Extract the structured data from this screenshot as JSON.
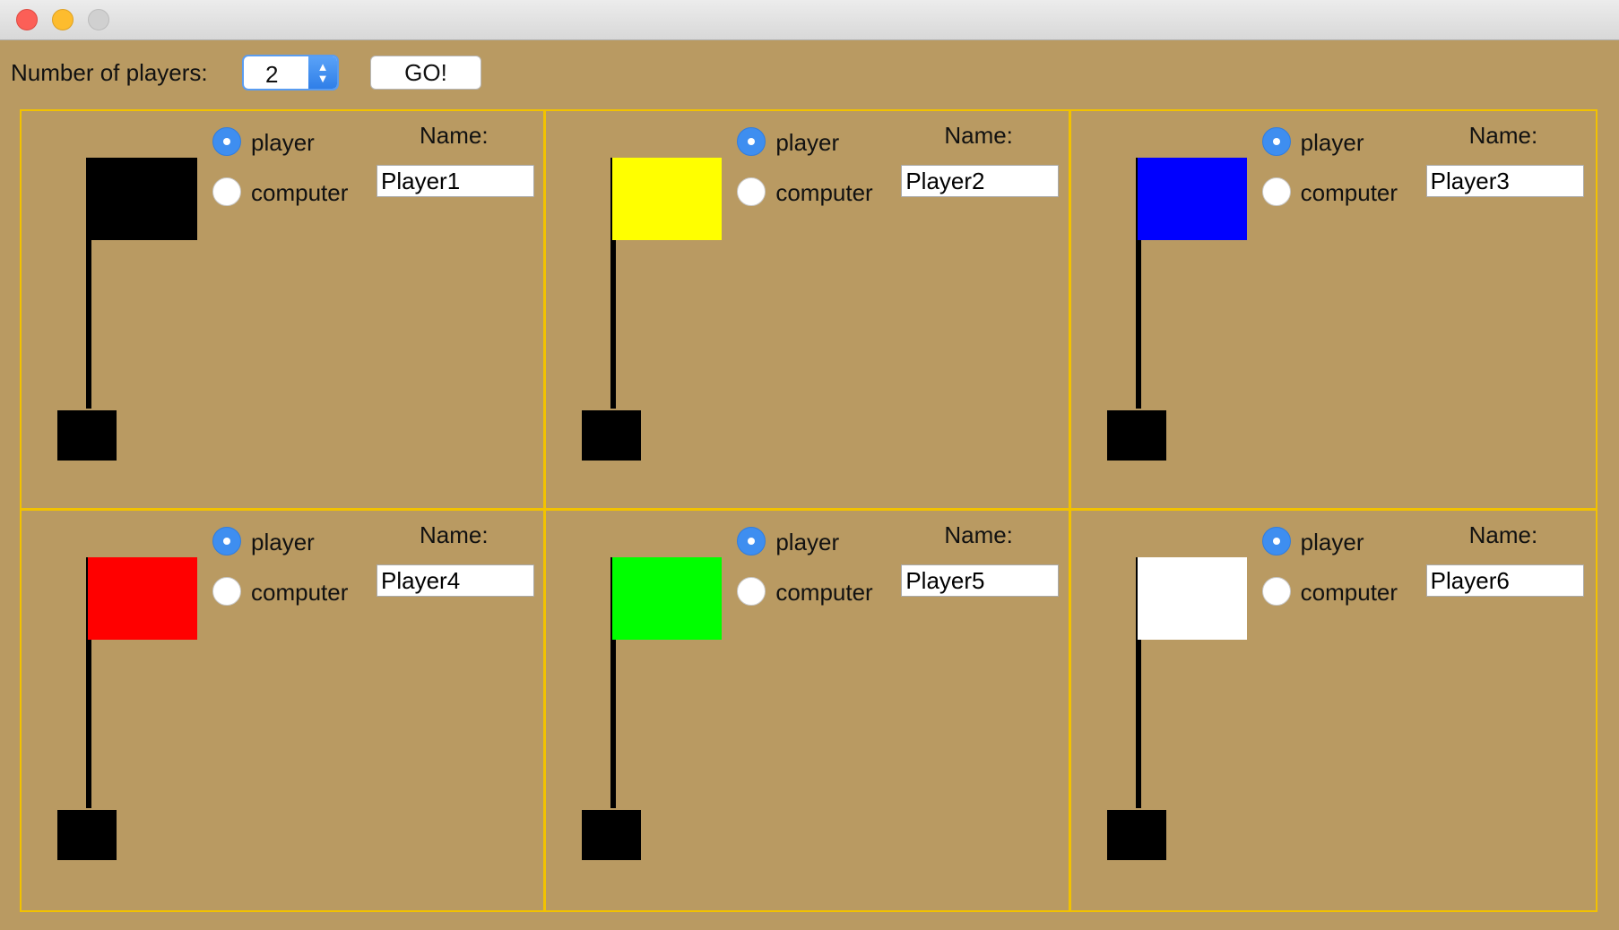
{
  "toolbar": {
    "players_label": "Number of players:",
    "players_value": "2",
    "go_label": "GO!"
  },
  "slots": [
    {
      "flag_color": "#000000",
      "player_label": "player",
      "computer_label": "computer",
      "selected": "player",
      "name_label": "Name:",
      "name": "Player1"
    },
    {
      "flag_color": "#ffff00",
      "player_label": "player",
      "computer_label": "computer",
      "selected": "player",
      "name_label": "Name:",
      "name": "Player2"
    },
    {
      "flag_color": "#0000ff",
      "player_label": "player",
      "computer_label": "computer",
      "selected": "player",
      "name_label": "Name:",
      "name": "Player3"
    },
    {
      "flag_color": "#ff0000",
      "player_label": "player",
      "computer_label": "computer",
      "selected": "player",
      "name_label": "Name:",
      "name": "Player4"
    },
    {
      "flag_color": "#00ff00",
      "player_label": "player",
      "computer_label": "computer",
      "selected": "player",
      "name_label": "Name:",
      "name": "Player5"
    },
    {
      "flag_color": "#ffffff",
      "player_label": "player",
      "computer_label": "computer",
      "selected": "player",
      "name_label": "Name:",
      "name": "Player6"
    }
  ],
  "colors": {
    "background": "#b99a62",
    "grid_border": "#f2c200",
    "radio_selected": "#3e8ef0"
  }
}
